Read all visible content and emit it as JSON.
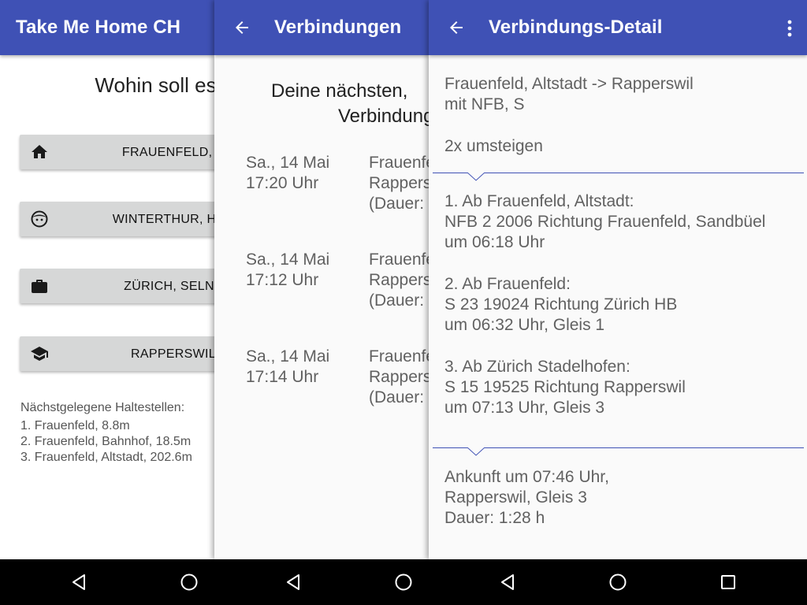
{
  "colors": {
    "primary": "#3f51b5",
    "button_bg": "#d6d7d7",
    "navbar": "#000000"
  },
  "home_screen": {
    "title": "Take Me Home CH",
    "question": "Wohin soll es",
    "destinations": [
      {
        "icon": "home-icon",
        "label": "FRAUENFELD, S"
      },
      {
        "icon": "face-icon",
        "label": "WINTERTHUR, HAU"
      },
      {
        "icon": "briefcase-icon",
        "label": "ZÜRICH, SELNA"
      },
      {
        "icon": "school-icon",
        "label": "RAPPERSWIL"
      }
    ],
    "nearby_title": "Nächstgelegene Haltestellen:",
    "nearby_stops": [
      "1. Frauenfeld, 8.8m",
      "2. Frauenfeld, Bahnhof, 18.5m",
      "3. Frauenfeld, Altstadt, 202.6m"
    ]
  },
  "connections_screen": {
    "title": "Verbindungen",
    "heading_line1": "Deine nächsten,",
    "heading_line2": "Verbindungen",
    "connections": [
      {
        "date": "Sa., 14 Mai",
        "time": "17:20 Uhr",
        "route_from": "Frauenfeld",
        "route_to": "Rapperswil",
        "duration": "(Dauer:"
      },
      {
        "date": "Sa., 14 Mai",
        "time": "17:12 Uhr",
        "route_from": "Frauenfeld",
        "route_to": "Rapperswil",
        "duration": "(Dauer:"
      },
      {
        "date": "Sa., 14 Mai",
        "time": "17:14 Uhr",
        "route_from": "Frauenfeld",
        "route_to": "Rapperswil",
        "duration": "(Dauer:"
      }
    ]
  },
  "detail_screen": {
    "title": "Verbindungs-Detail",
    "route": "Frauenfeld, Altstadt -> Rapperswil",
    "operator": "mit NFB, S",
    "transfers": "2x umsteigen",
    "legs": [
      {
        "line1": "1. Ab Frauenfeld, Altstadt:",
        "line2": "NFB 2 2006 Richtung Frauenfeld, Sandbüel",
        "line3": "um 06:18 Uhr"
      },
      {
        "line1": "2. Ab Frauenfeld:",
        "line2": "S 23 19024 Richtung Zürich HB",
        "line3": "um 06:32 Uhr, Gleis 1"
      },
      {
        "line1": "3. Ab Zürich Stadelhofen:",
        "line2": "S 15 19525 Richtung Rapperswil",
        "line3": "um 07:13 Uhr, Gleis 3"
      }
    ],
    "arrival_line1": "Ankunft um 07:46 Uhr,",
    "arrival_line2": "Rapperswil, Gleis 3",
    "arrival_line3": "Dauer: 1:28 h"
  }
}
